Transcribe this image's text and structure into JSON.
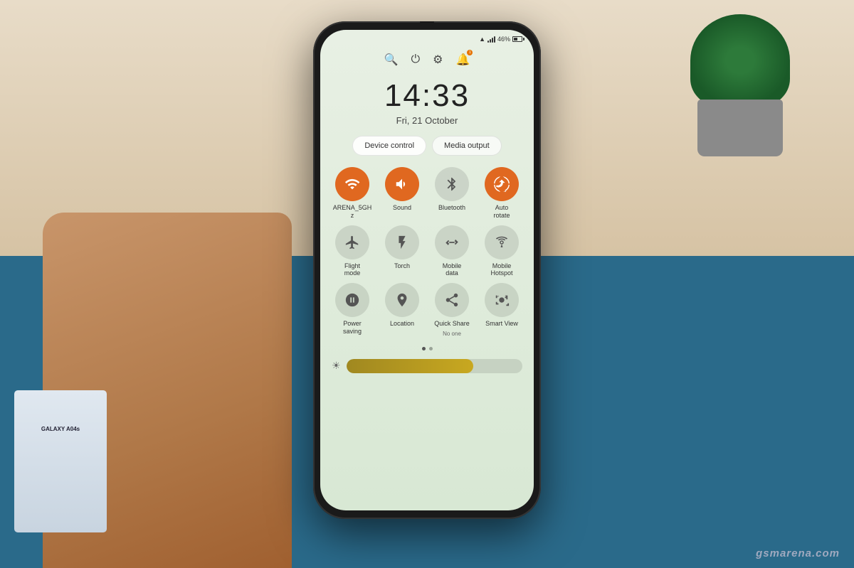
{
  "scene": {
    "watermark": "gsmarena.com"
  },
  "phone": {
    "status_bar": {
      "wifi": "▾",
      "signal": "▋",
      "battery_percent": "46%"
    },
    "header_icons": {
      "search_label": "🔍",
      "power_label": "⏻",
      "settings_label": "⚙",
      "notifications_label": "🔔",
      "notification_count": "1"
    },
    "clock": {
      "time": "14:33",
      "date": "Fri, 21 October"
    },
    "buttons": {
      "device_control": "Device control",
      "media_output": "Media output"
    },
    "tiles": [
      {
        "id": "wifi",
        "icon": "wifi",
        "label": "ARENA_5GH\nz",
        "active": true
      },
      {
        "id": "sound",
        "icon": "sound",
        "label": "Sound",
        "active": true
      },
      {
        "id": "bluetooth",
        "icon": "bluetooth",
        "label": "Bluetooth",
        "active": false
      },
      {
        "id": "auto-rotate",
        "icon": "rotate",
        "label": "Auto\nrotate",
        "active": true
      },
      {
        "id": "flight-mode",
        "icon": "flight",
        "label": "Flight\nmode",
        "active": false
      },
      {
        "id": "torch",
        "icon": "torch",
        "label": "Torch",
        "active": false
      },
      {
        "id": "mobile-data",
        "icon": "data",
        "label": "Mobile\ndata",
        "active": false
      },
      {
        "id": "mobile-hotspot",
        "icon": "hotspot",
        "label": "Mobile\nHotspot",
        "active": false
      },
      {
        "id": "power-saving",
        "icon": "power-save",
        "label": "Power\nsaving",
        "active": false
      },
      {
        "id": "location",
        "icon": "location",
        "label": "Location",
        "active": false
      },
      {
        "id": "quick-share",
        "icon": "share",
        "label": "Quick Share",
        "sublabel": "No one",
        "active": false
      },
      {
        "id": "smart-view",
        "icon": "cast",
        "label": "Smart View",
        "active": false
      }
    ],
    "dots": [
      true,
      false
    ],
    "brightness": {
      "value": 72
    }
  }
}
